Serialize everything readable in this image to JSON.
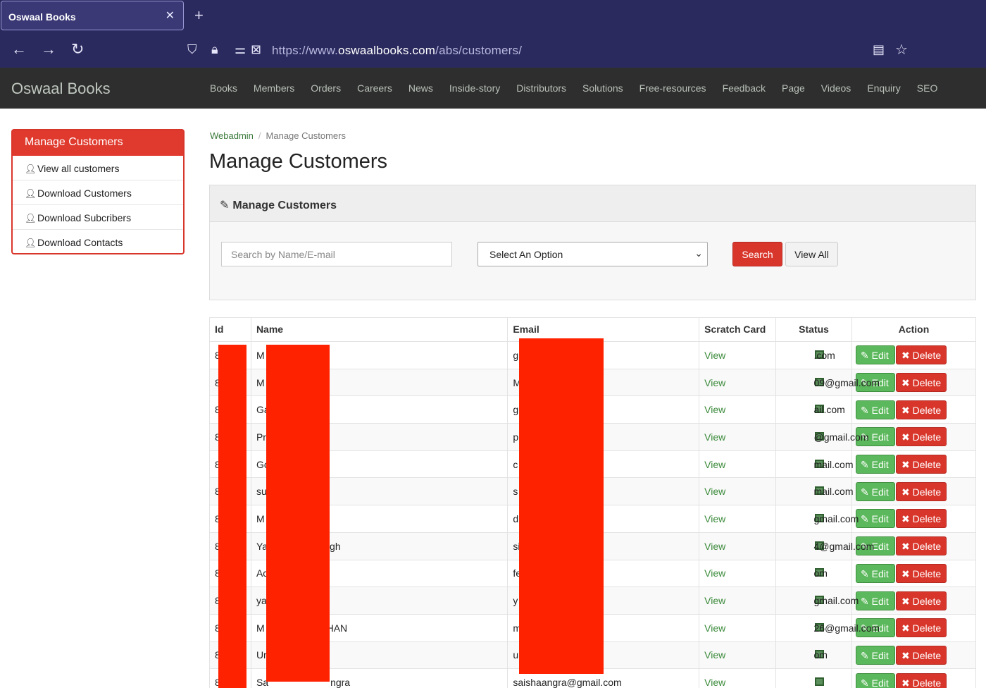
{
  "browser": {
    "tab_title": "Oswaal Books",
    "tab_close": "✕",
    "new_tab": "+",
    "url_prefix": "https://www.",
    "url_domain": "oswaalbooks.com",
    "url_path": "/abs/customers/"
  },
  "site": {
    "brand": "Oswaal Books",
    "nav": [
      "Books",
      "Members",
      "Orders",
      "Careers",
      "News",
      "Inside-story",
      "Distributors",
      "Solutions",
      "Free-resources",
      "Feedback",
      "Page",
      "Videos",
      "Enquiry",
      "SEO"
    ]
  },
  "sidebar": {
    "heading": "Manage Customers",
    "items": [
      "View all customers",
      "Download Customers",
      "Download Subcribers",
      "Download Contacts"
    ]
  },
  "breadcrumb": {
    "link": "Webadmin",
    "separator": "/",
    "current": "Manage Customers"
  },
  "page_title": "Manage Customers",
  "panel": {
    "heading": "Manage Customers",
    "search_placeholder": "Search by Name/E-mail",
    "select_value": "Select An Option",
    "search_button": "Search",
    "viewall_button": "View All"
  },
  "table": {
    "headers": [
      "Id",
      "Name",
      "Email",
      "Scratch Card",
      "Status",
      "Action"
    ],
    "view_label": "View",
    "edit_label": "Edit",
    "delete_label": "Delete",
    "rows": [
      {
        "id": "8",
        "name": "M",
        "email_start": "g",
        "email_end": ".com"
      },
      {
        "id": "8",
        "name": "M",
        "email_start": "M",
        "email_end": "09@gmail.com"
      },
      {
        "id": "8",
        "name": "Ga",
        "email_start": "g",
        "email_end": "ail.com"
      },
      {
        "id": "8",
        "name": "Pr",
        "email_start": "p",
        "email_end": "@gmail.com"
      },
      {
        "id": "8",
        "name": "Gc",
        "email_start": "c",
        "email_end": "mail.com"
      },
      {
        "id": "8",
        "name": "su",
        "email_start": "s",
        "email_end": "mail.com"
      },
      {
        "id": "8",
        "name": "M",
        "email_start": "d",
        "email_end": "gmail.com"
      },
      {
        "id": "8",
        "name": "Ya",
        "name_end": "gh",
        "email_start": "si",
        "email_end": "4@gmail.com"
      },
      {
        "id": "8",
        "name": "Ac",
        "email_start": "fe",
        "email_end": "om"
      },
      {
        "id": "8",
        "name": "ya",
        "email_start": "y",
        "email_end": "gmail.com"
      },
      {
        "id": "8",
        "name": "M",
        "name_end": "HAN",
        "email_start": "m",
        "email_end": "26@gmail.com"
      },
      {
        "id": "8",
        "name": "Ur",
        "email_start": "u",
        "email_end": "om"
      },
      {
        "id": "8",
        "name": "Sa",
        "name_end": "ngra",
        "email_start": "saishaangra@gmail.com",
        "email_end": ""
      }
    ]
  },
  "colors": {
    "brand_red": "#d9362b",
    "success_green": "#5cb85c",
    "redaction": "#ff2200"
  }
}
